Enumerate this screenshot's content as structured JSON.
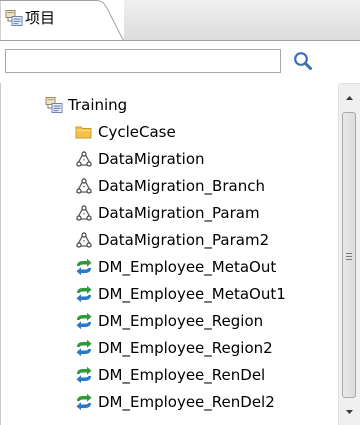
{
  "tab": {
    "label": "项目",
    "icon": "project-tree-icon"
  },
  "search": {
    "value": "",
    "placeholder": "",
    "button_icon": "search-icon"
  },
  "tree": {
    "root": {
      "label": "Training",
      "icon": "project-tree-icon"
    },
    "items": [
      {
        "label": "CycleCase",
        "icon": "folder-icon"
      },
      {
        "label": "DataMigration",
        "icon": "data-migration-icon"
      },
      {
        "label": "DataMigration_Branch",
        "icon": "data-migration-icon"
      },
      {
        "label": "DataMigration_Param",
        "icon": "data-migration-icon"
      },
      {
        "label": "DataMigration_Param2",
        "icon": "data-migration-icon"
      },
      {
        "label": "DM_Employee_MetaOut",
        "icon": "sync-arrows-icon"
      },
      {
        "label": "DM_Employee_MetaOut1",
        "icon": "sync-arrows-icon"
      },
      {
        "label": "DM_Employee_Region",
        "icon": "sync-arrows-icon"
      },
      {
        "label": "DM_Employee_Region2",
        "icon": "sync-arrows-icon"
      },
      {
        "label": "DM_Employee_RenDel",
        "icon": "sync-arrows-icon"
      },
      {
        "label": "DM_Employee_RenDel2",
        "icon": "sync-arrows-icon"
      }
    ]
  },
  "colors": {
    "folder": "#f5c64a",
    "sync_green": "#2f9a3a",
    "sync_blue": "#2a79c9",
    "migration_gray": "#6c6c6c"
  }
}
